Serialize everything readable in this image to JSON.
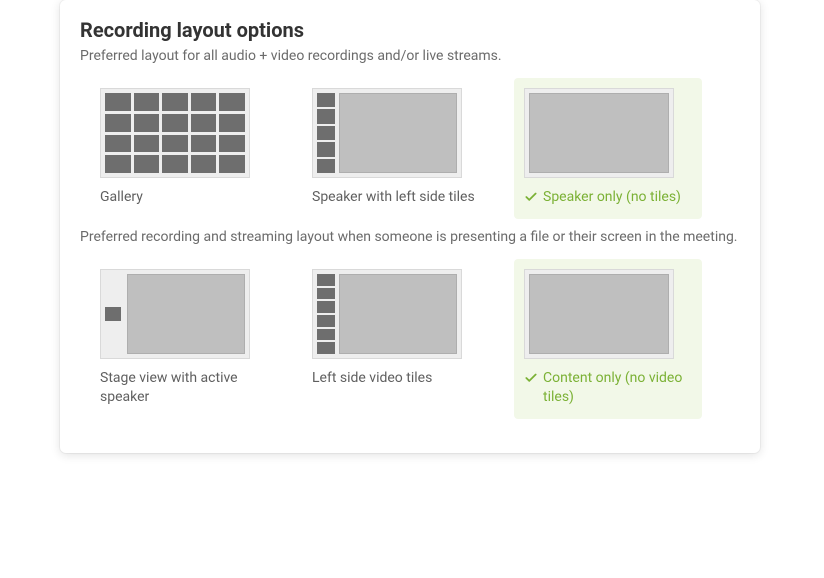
{
  "title": "Recording layout options",
  "section_a": {
    "subhead": "Preferred layout for all audio + video recordings and/or live streams.",
    "options": [
      {
        "label": "Gallery",
        "selected": false
      },
      {
        "label": "Speaker with left side tiles",
        "selected": false
      },
      {
        "label": "Speaker only (no tiles)",
        "selected": true
      }
    ]
  },
  "section_b": {
    "subhead": "Preferred recording and streaming layout when someone is presenting a file or their screen in the meeting.",
    "options": [
      {
        "label": "Stage view with active speaker",
        "selected": false
      },
      {
        "label": "Left side video tiles",
        "selected": false
      },
      {
        "label": "Content only (no video tiles)",
        "selected": true
      }
    ]
  },
  "colors": {
    "accent": "#7bb135"
  }
}
